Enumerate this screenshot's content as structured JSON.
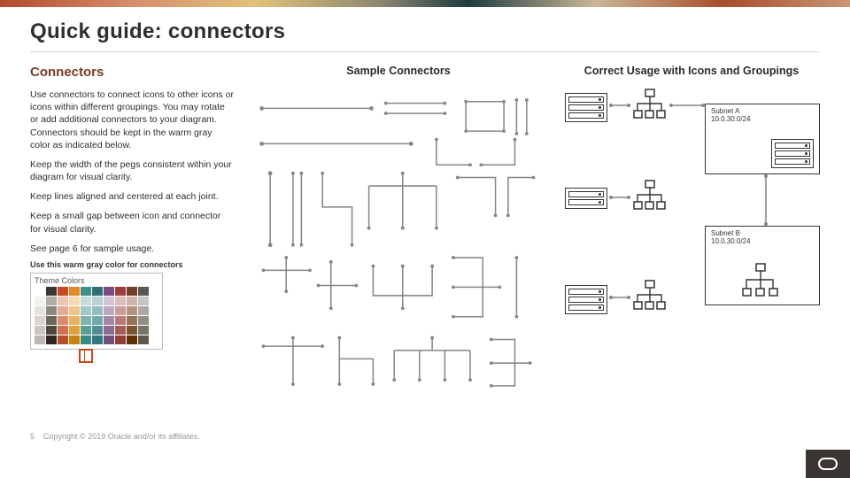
{
  "title": "Quick guide: connectors",
  "left": {
    "heading": "Connectors",
    "p1": "Use connectors to connect icons to other icons or icons within different groupings. You may rotate or add additional connectors to your diagram. Connectors should be kept in the warm gray color as indicated below.",
    "p2": "Keep the width of the pegs consistent within your diagram for visual clarity.",
    "p3": "Keep lines aligned and centered at each joint.",
    "p4": "Keep a small gap between icon and connector for visual clarity.",
    "p5": "See page 6 for sample usage.",
    "note": "Use this warm gray color for connectors",
    "swatch_title": "Theme Colors"
  },
  "mid": {
    "heading": "Sample Connectors"
  },
  "right": {
    "heading": "Correct Usage with Icons and Groupings",
    "subnetA_label": "Subnet A",
    "subnetA_cidr": "10.0.30.0/24",
    "subnetB_label": "Subnet B",
    "subnetB_cidr": "10.0.30.0/24"
  },
  "footer": {
    "page": "5",
    "copyright": "Copyright © 2019 Oracle and/or its affiliates."
  },
  "connector_color": "#8a8580",
  "swatch_rows": [
    [
      "#ffffff",
      "#3a3631",
      "#c74b1d",
      "#e08a28",
      "#3e8e8b",
      "#2f6f73",
      "#7a4d7e",
      "#9c3f3a",
      "#733f2a",
      "#5a5752"
    ],
    [
      "#f2f1ef",
      "#b1aaa1",
      "#f0c3b0",
      "#f5d9b3",
      "#c3ddda",
      "#b9d1d3",
      "#d5c4d7",
      "#e0bcb9",
      "#cdb6ab",
      "#c7c4bf"
    ],
    [
      "#e5e3e0",
      "#8f877d",
      "#e6a88f",
      "#efc68a",
      "#9fc9c4",
      "#95bcbf",
      "#bca6c0",
      "#cc9c97",
      "#b2947f",
      "#ada9a2"
    ],
    [
      "#d8d5d1",
      "#6f665b",
      "#da8c6d",
      "#e8b260",
      "#7bb5ad",
      "#73a7ab",
      "#a389a9",
      "#b87d76",
      "#967355",
      "#938e86"
    ],
    [
      "#cac6c1",
      "#4f463b",
      "#cf714c",
      "#e19f38",
      "#58a197",
      "#528f95",
      "#8a6c92",
      "#a45e55",
      "#7b522c",
      "#79736a"
    ],
    [
      "#bdb8b2",
      "#2f271d",
      "#b54f27",
      "#c78414",
      "#388d80",
      "#34787f",
      "#71507b",
      "#903f35",
      "#603203",
      "#5f584e"
    ]
  ]
}
